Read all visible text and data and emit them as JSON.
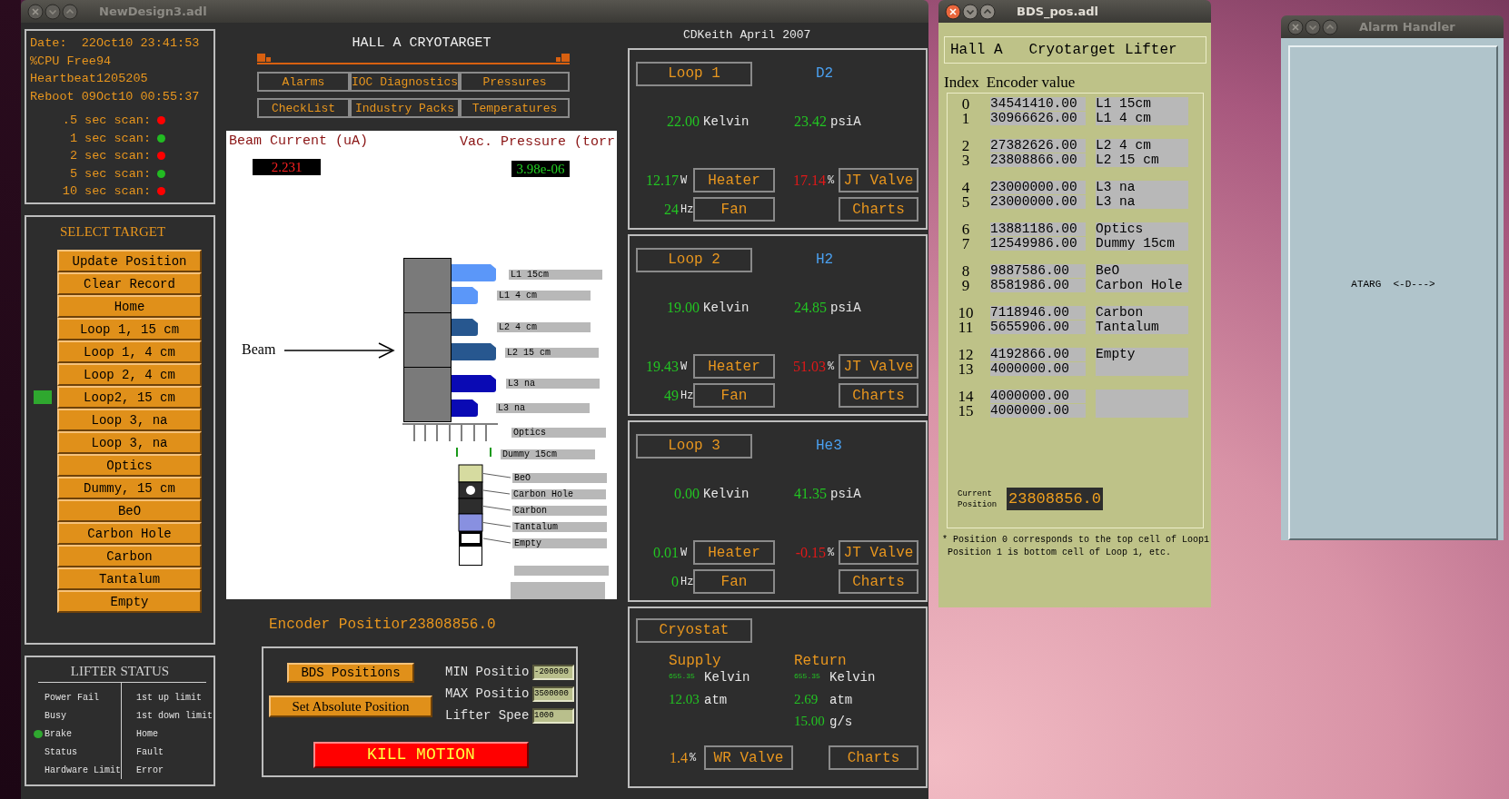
{
  "main_window": {
    "title": "NewDesign3.adl",
    "active": false,
    "status": {
      "lines": [
        "Date:  22Oct10 23:41:53",
        "%CPU Free94",
        "Heartbeat1205205",
        "Reboot 09Oct10 00:55:37"
      ],
      "scans": [
        {
          "label": ".5 sec scan:",
          "color": "#ff0000"
        },
        {
          "label": "1 sec scan:",
          "color": "#22bb22"
        },
        {
          "label": "2 sec scan:",
          "color": "#ff0000"
        },
        {
          "label": "5 sec scan:",
          "color": "#22bb22"
        },
        {
          "label": "10 sec scan:",
          "color": "#ff0000"
        }
      ]
    },
    "select_target": {
      "title": "SELECT TARGET",
      "targets": [
        {
          "label": "Update Position",
          "selected": false
        },
        {
          "label": "Clear Record",
          "selected": false
        },
        {
          "label": "Home",
          "selected": false
        },
        {
          "label": "Loop 1, 15 cm",
          "selected": false
        },
        {
          "label": "Loop 1, 4 cm",
          "selected": false
        },
        {
          "label": "Loop 2, 4 cm",
          "selected": false
        },
        {
          "label": "Loop2, 15 cm",
          "selected": true
        },
        {
          "label": "Loop 3, na",
          "selected": false
        },
        {
          "label": "Loop 3, na",
          "selected": false
        },
        {
          "label": "Optics",
          "selected": false
        },
        {
          "label": "Dummy, 15 cm",
          "selected": false
        },
        {
          "label": "BeO",
          "selected": false
        },
        {
          "label": "Carbon Hole",
          "selected": false
        },
        {
          "label": "Carbon",
          "selected": false
        },
        {
          "label": "Tantalum",
          "selected": false
        },
        {
          "label": "Empty",
          "selected": false
        }
      ]
    },
    "lifter_status": {
      "title": "LIFTER STATUS",
      "left": [
        {
          "label": "Power Fail",
          "on": false
        },
        {
          "label": "Busy",
          "on": false
        },
        {
          "label": "Brake",
          "on": true
        },
        {
          "label": "Status",
          "on": false
        },
        {
          "label": "Hardware Limit",
          "on": false
        }
      ],
      "right": [
        {
          "label": "1st up limit",
          "on": false
        },
        {
          "label": "1st down limit",
          "on": false
        },
        {
          "label": "Home",
          "on": false
        },
        {
          "label": "Fault",
          "on": false
        },
        {
          "label": "Error",
          "on": false
        }
      ]
    },
    "header": {
      "title": "HALL A CRYOTARGET",
      "nav": [
        "Alarms",
        "IOC Diagnostics",
        "Pressures",
        "CheckList",
        "Industry Packs",
        "Temperatures"
      ]
    },
    "diagram": {
      "beam_current_label": "Beam Current (uA)",
      "beam_current": "2.231",
      "vac_pressure_label": "Vac. Pressure (torr",
      "vac_pressure": "3.98e-06",
      "beam_label": "Beam",
      "cells": [
        {
          "label": "L1 15cm",
          "color": "#5b97f9"
        },
        {
          "label": "L1 4 cm",
          "color": "#5b97f9"
        },
        {
          "label": "L2 4 cm",
          "color": "#27578f"
        },
        {
          "label": "L2 15 cm",
          "color": "#27578f"
        },
        {
          "label": "L3 na",
          "color": "#0a0ab4"
        },
        {
          "label": "L3 na",
          "color": "#0a0ab4"
        }
      ],
      "other_labels": [
        "Optics",
        "Dummy 15cm"
      ],
      "solid_targets": [
        {
          "label": "BeO",
          "kind": "solid",
          "color": "#d6dba0"
        },
        {
          "label": "Carbon Hole",
          "kind": "hole",
          "color": "#2d2d2d"
        },
        {
          "label": "Carbon",
          "kind": "solid",
          "color": "#2d2d2d"
        },
        {
          "label": "Tantalum",
          "kind": "solid",
          "color": "#8890e0"
        },
        {
          "label": "Empty",
          "kind": "frame",
          "color": "#000000"
        }
      ]
    },
    "encoder": {
      "label": "Encoder Positior",
      "value": "23808856.0"
    },
    "motion": {
      "bds_button": "BDS Positions",
      "set_button": "Set Absolute Position",
      "fields": [
        {
          "label": "MIN Positio",
          "value": "-200000"
        },
        {
          "label": "MAX Positio",
          "value": "3500000"
        },
        {
          "label": "Lifter Spee",
          "value": "1000"
        }
      ],
      "kill_button": "KILL MOTION"
    },
    "credit": "CDKeith April 2007",
    "loops": [
      {
        "name": "Loop 1",
        "gas": "D2",
        "temperature": "22.00",
        "temperature_unit": "Kelvin",
        "pressure": "23.42",
        "pressure_unit": "psiA",
        "heater_power": "12.17",
        "heater_unit": "W",
        "heater_button": "Heater",
        "jt_valve": "17.14",
        "jt_unit": "%",
        "jt_button": "JT Valve",
        "fan_speed": "24",
        "fan_unit": "Hz",
        "fan_button": "Fan",
        "charts_button": "Charts"
      },
      {
        "name": "Loop 2",
        "gas": "H2",
        "temperature": "19.00",
        "temperature_unit": "Kelvin",
        "pressure": "24.85",
        "pressure_unit": "psiA",
        "heater_power": "19.43",
        "heater_unit": "W",
        "heater_button": "Heater",
        "jt_valve": "51.03",
        "jt_unit": "%",
        "jt_button": "JT Valve",
        "fan_speed": "49",
        "fan_unit": "Hz",
        "fan_button": "Fan",
        "charts_button": "Charts"
      },
      {
        "name": "Loop 3",
        "gas": "He3",
        "temperature": "0.00",
        "temperature_unit": "Kelvin",
        "pressure": "41.35",
        "pressure_unit": "psiA",
        "heater_power": "0.01",
        "heater_unit": "W",
        "heater_button": "Heater",
        "jt_valve": "-0.15",
        "jt_unit": "%",
        "jt_button": "JT Valve",
        "fan_speed": "0",
        "fan_unit": "Hz",
        "fan_button": "Fan",
        "charts_button": "Charts"
      }
    ],
    "cryostat": {
      "name": "Cryostat",
      "supply": {
        "title": "Supply",
        "temperature": "655.35",
        "temperature_unit": "Kelvin",
        "pressure": "12.03",
        "pressure_unit": "atm"
      },
      "return": {
        "title": "Return",
        "temperature": "655.35",
        "temperature_unit": "Kelvin",
        "pressure": "2.69",
        "pressure_unit": "atm",
        "flow": "15.00",
        "flow_unit": "g/s"
      },
      "wr_valve": "1.4",
      "wr_unit": "%",
      "wr_button": "WR Valve",
      "charts_button": "Charts"
    }
  },
  "bds_window": {
    "title": "BDS_pos.adl",
    "active": true,
    "heading": "Hall A   Cryotarget Lifter",
    "columns": [
      "Index",
      "Encoder value"
    ],
    "groups": [
      {
        "rows": [
          {
            "index": "0",
            "value": "34541410.00",
            "label": "L1 15cm"
          },
          {
            "index": "1",
            "value": "30966626.00",
            "label": "L1 4 cm"
          }
        ]
      },
      {
        "rows": [
          {
            "index": "2",
            "value": "27382626.00",
            "label": "L2 4 cm"
          },
          {
            "index": "3",
            "value": "23808866.00",
            "label": "L2 15 cm"
          }
        ]
      },
      {
        "rows": [
          {
            "index": "4",
            "value": "23000000.00",
            "label": "L3 na"
          },
          {
            "index": "5",
            "value": "23000000.00",
            "label": "L3 na"
          }
        ]
      },
      {
        "rows": [
          {
            "index": "6",
            "value": "13881186.00",
            "label": "Optics"
          },
          {
            "index": "7",
            "value": "12549986.00",
            "label": "Dummy 15cm"
          }
        ]
      },
      {
        "rows": [
          {
            "index": "8",
            "value": "9887586.00",
            "label": "BeO"
          },
          {
            "index": "9",
            "value": "8581986.00",
            "label": "Carbon Hole"
          }
        ]
      },
      {
        "rows": [
          {
            "index": "10",
            "value": "7118946.00",
            "label": "Carbon"
          },
          {
            "index": "11",
            "value": "5655906.00",
            "label": "Tantalum"
          }
        ]
      },
      {
        "rows": [
          {
            "index": "12",
            "value": "4192866.00",
            "label": "Empty"
          },
          {
            "index": "13",
            "value": "4000000.00"
          }
        ]
      },
      {
        "rows": [
          {
            "index": "14",
            "value": "4000000.00"
          },
          {
            "index": "15",
            "value": "4000000.00"
          }
        ]
      }
    ],
    "current_label": "Current Position",
    "current_value": "23808856.0",
    "notes": [
      "* Position 0 corresponds to the top cell of Loop1",
      "Position 1 is bottom cell of Loop 1, etc."
    ]
  },
  "alarm_window": {
    "title": "Alarm Handler",
    "active": false,
    "group": "ATARG  <-D--->"
  }
}
